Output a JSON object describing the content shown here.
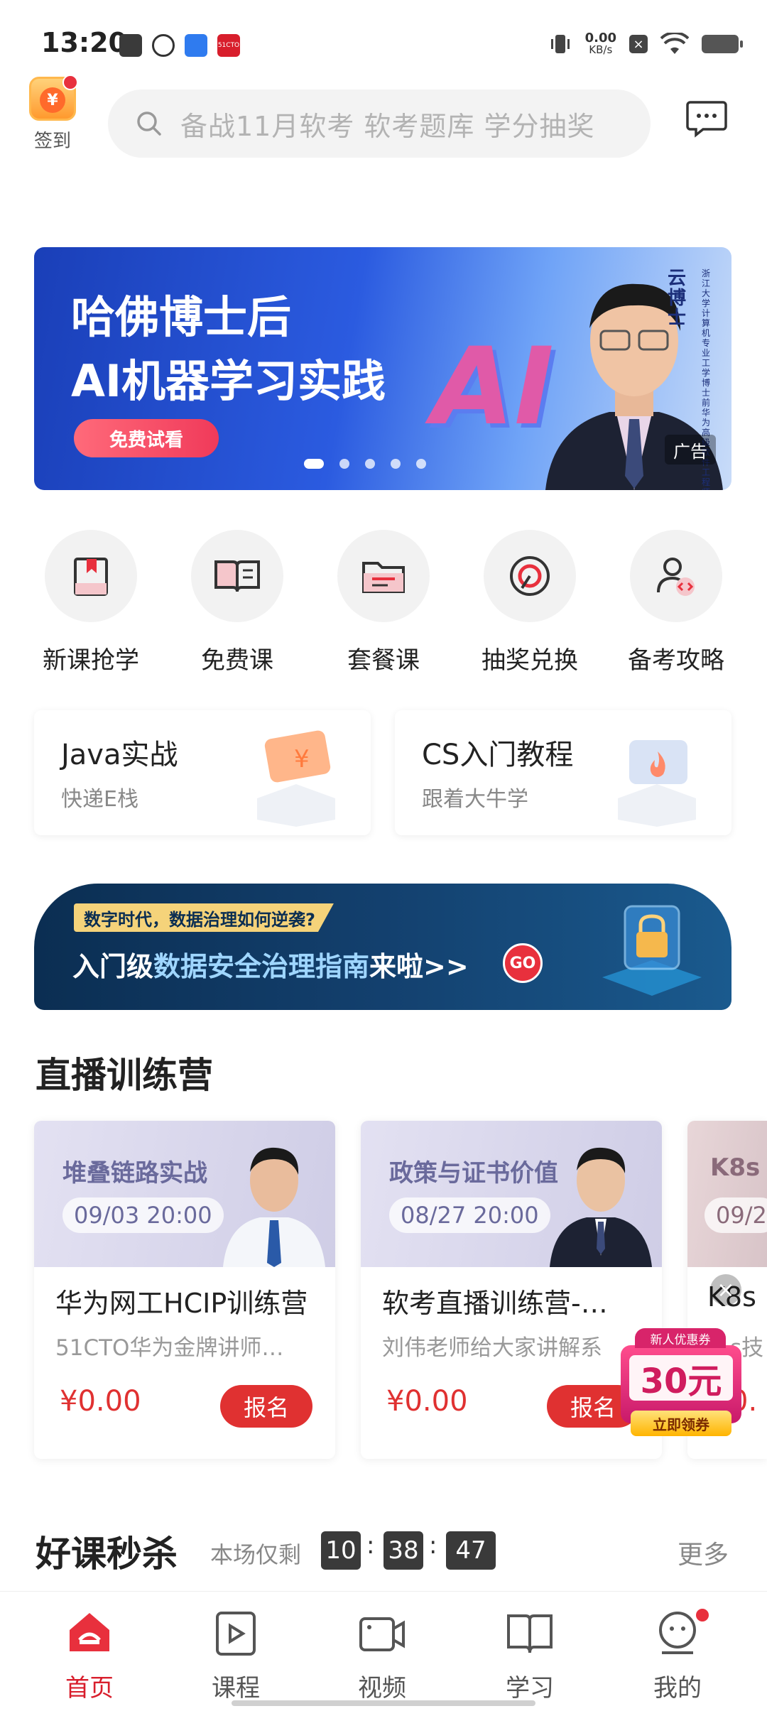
{
  "status": {
    "time": "13:20",
    "net_speed": "0.00",
    "net_unit": "KB/s",
    "app_badge": "51CTO"
  },
  "header": {
    "checkin_label": "签到",
    "search_placeholder": "备战11月软考 软考题库 学分抽奖"
  },
  "banner": {
    "line1": "哈佛博士后",
    "line2": "AI机器学习实践",
    "cta": "免费试看",
    "ai_text": "AI",
    "speaker": "云博士",
    "speaker_desc": "浙江大学计算机专业工学博士 前华为高级软件工程师",
    "ad_label": "广告",
    "slide_count": 5,
    "active_slide": 0
  },
  "quick_nav": [
    {
      "label": "新课抢学",
      "icon": "bookmark-book-icon"
    },
    {
      "label": "免费课",
      "icon": "open-book-icon"
    },
    {
      "label": "套餐课",
      "icon": "folder-icon"
    },
    {
      "label": "抽奖兑换",
      "icon": "spin-wheel-icon"
    },
    {
      "label": "备考攻略",
      "icon": "user-code-icon"
    }
  ],
  "promo_cards": [
    {
      "title": "Java实战",
      "subtitle": "快递E栈",
      "icon": "ticket-yen-icon"
    },
    {
      "title": "CS入门教程",
      "subtitle": "跟着大牛学",
      "icon": "flame-box-icon"
    }
  ],
  "security_banner": {
    "tag": "数字时代，数据治理如何逆袭?",
    "main_prefix": "入门级",
    "main_highlight": "数据安全治理指南",
    "main_suffix": "来啦>>",
    "go": "GO"
  },
  "live_section": {
    "title": "直播训练营",
    "cards": [
      {
        "topic": "堆叠链路实战",
        "datetime": "09/03 20:00",
        "title": "华为网工HCIP训练营",
        "subtitle": "51CTO华为金牌讲师…",
        "price": "¥0.00",
        "action": "报名"
      },
      {
        "topic": "政策与证书价值",
        "datetime": "08/27 20:00",
        "title": "软考直播训练营-…",
        "subtitle": "刘伟老师给大家讲解系",
        "price": "¥0.00",
        "action": "报名"
      },
      {
        "topic": "K8s",
        "datetime": "09/2",
        "title": "K8s",
        "subtitle": "s技",
        "price": "0.",
        "action": ""
      }
    ]
  },
  "coupon": {
    "top": "新人优惠券",
    "amount": "30元",
    "action": "立即领券"
  },
  "flash_sale": {
    "title": "好课秒杀",
    "remain_label": "本场仅剩",
    "hours": "10",
    "minutes": "38",
    "seconds": "47",
    "more": "更多"
  },
  "tabbar": [
    {
      "label": "首页",
      "icon": "home-icon",
      "active": true
    },
    {
      "label": "课程",
      "icon": "play-course-icon",
      "active": false
    },
    {
      "label": "视频",
      "icon": "video-camera-icon",
      "active": false
    },
    {
      "label": "学习",
      "icon": "book-icon",
      "active": false
    },
    {
      "label": "我的",
      "icon": "profile-face-icon",
      "active": false
    }
  ],
  "colors": {
    "brand_red": "#d81e2c",
    "price_red": "#e03131",
    "banner_blue": "#2b5be0"
  }
}
